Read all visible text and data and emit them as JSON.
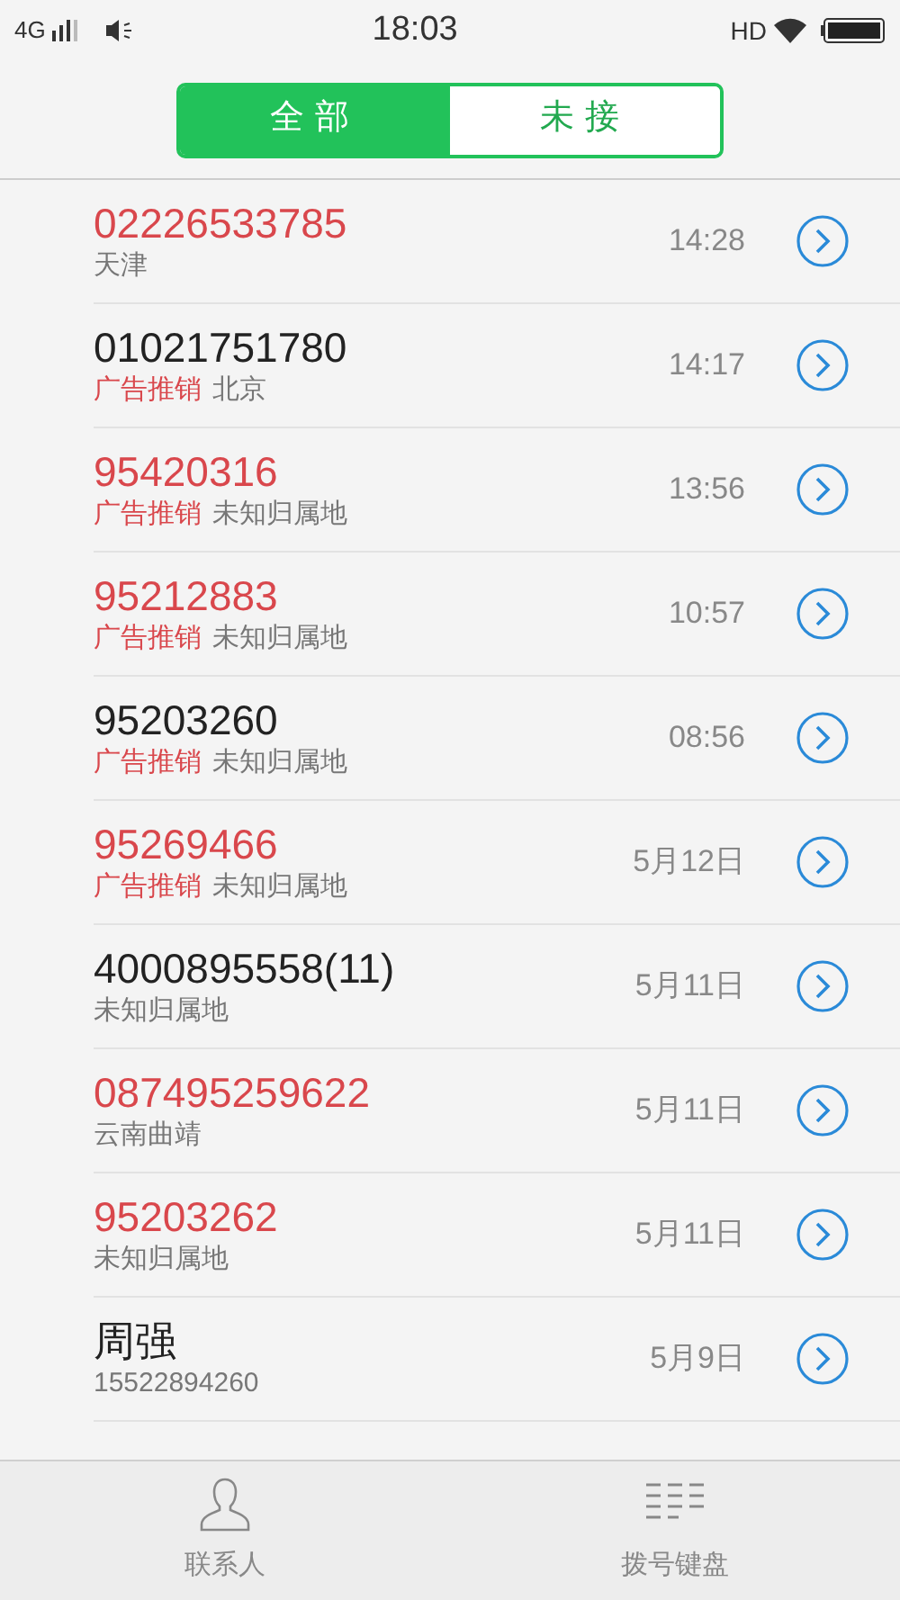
{
  "status_bar": {
    "network": "4G",
    "time": "18:03",
    "hd": "HD"
  },
  "tabs": [
    {
      "label": "全部",
      "selected": true
    },
    {
      "label": "未接",
      "selected": false
    }
  ],
  "calls": [
    {
      "number": "02226533785",
      "missed": true,
      "location": "天津",
      "time": "14:28"
    },
    {
      "number": "01021751780",
      "missed": false,
      "tag": "广告推销",
      "location": "北京",
      "time": "14:17"
    },
    {
      "number": "95420316",
      "missed": true,
      "tag": "广告推销",
      "location": "未知归属地",
      "time": "13:56"
    },
    {
      "number": "95212883",
      "missed": true,
      "tag": "广告推销",
      "location": "未知归属地",
      "time": "10:57"
    },
    {
      "number": "95203260",
      "missed": false,
      "tag": "广告推销",
      "location": "未知归属地",
      "time": "08:56"
    },
    {
      "number": "95269466",
      "missed": true,
      "tag": "广告推销",
      "location": "未知归属地",
      "time": "5月12日"
    },
    {
      "number": "4000895558(11)",
      "missed": false,
      "location": "未知归属地",
      "time": "5月11日"
    },
    {
      "number": "087495259622",
      "missed": true,
      "location": "云南曲靖",
      "time": "5月11日"
    },
    {
      "number": "95203262",
      "missed": true,
      "location": "未知归属地",
      "time": "5月11日"
    },
    {
      "number": "周强",
      "missed": false,
      "location": "15522894260",
      "time": "5月9日"
    }
  ],
  "bottom_nav": [
    {
      "label": "联系人",
      "kind": "contacts"
    },
    {
      "label": "拨号键盘",
      "kind": "dialpad"
    }
  ]
}
